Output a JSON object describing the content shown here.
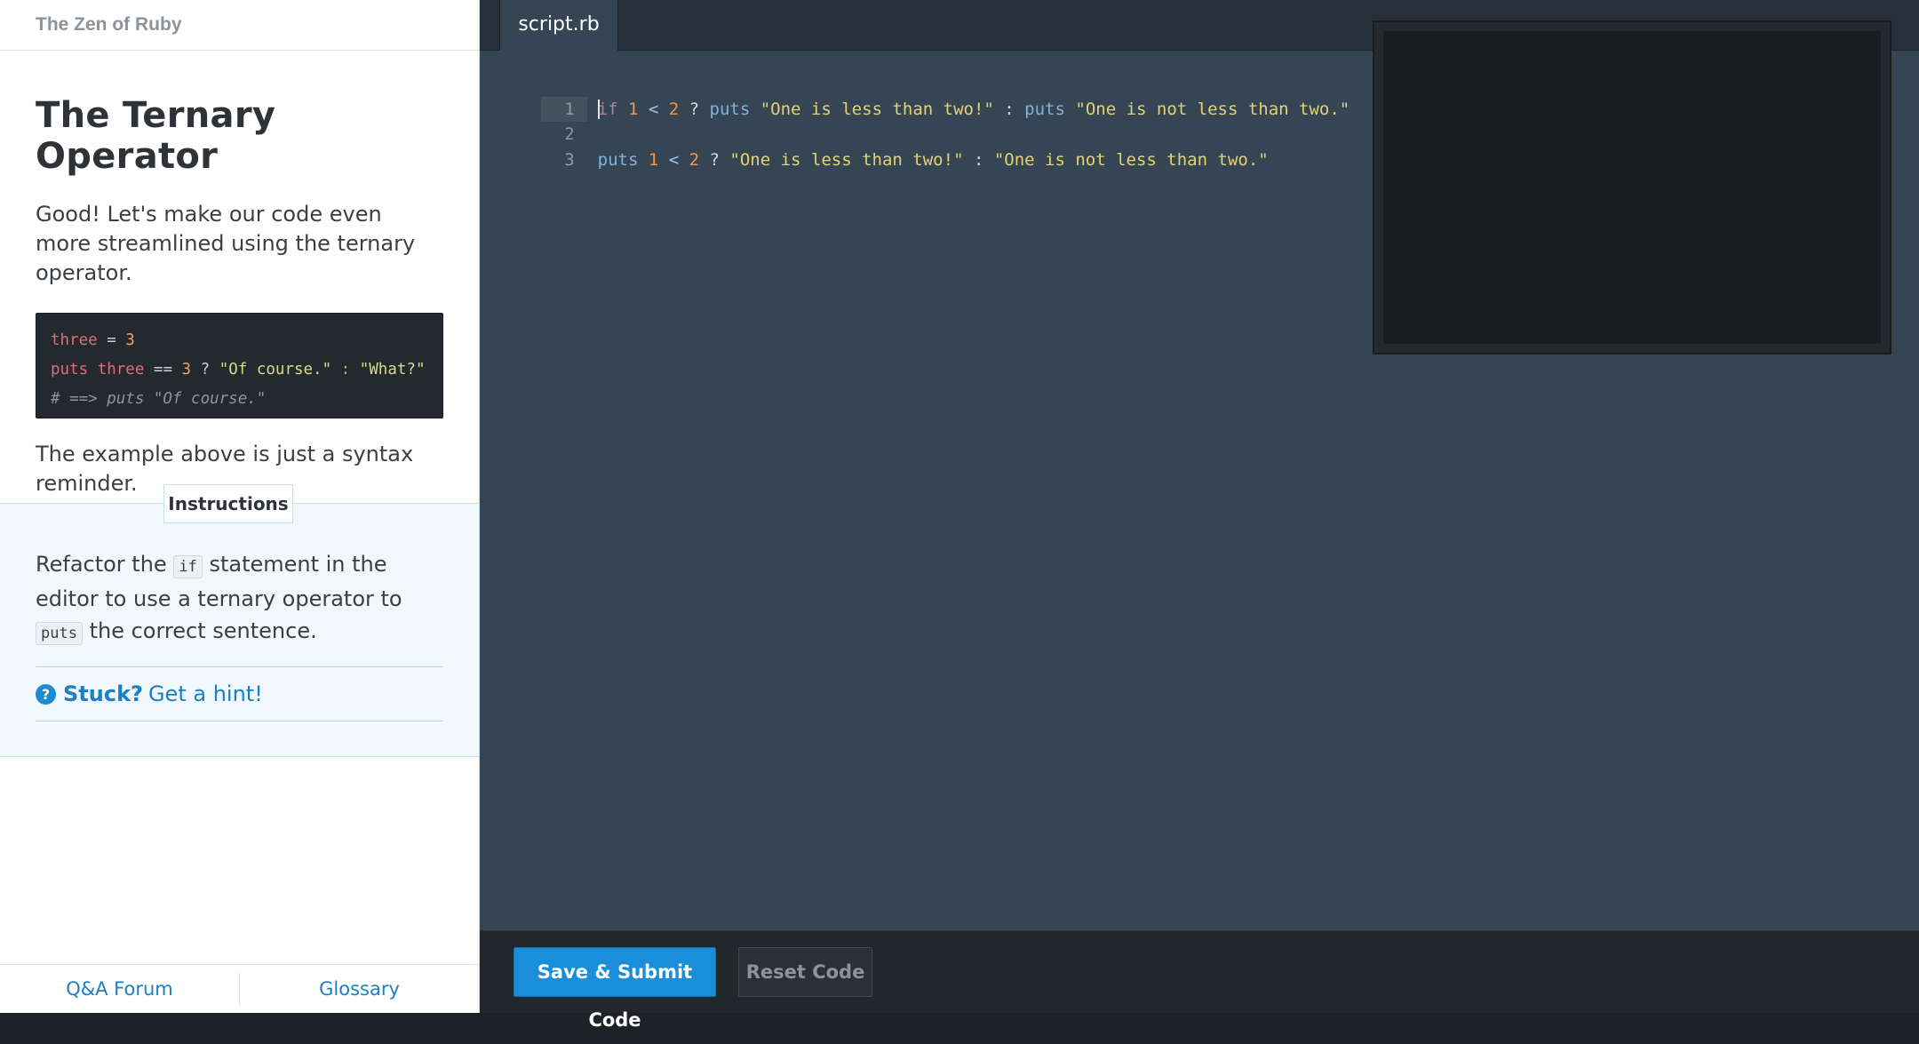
{
  "sidebar": {
    "course_title": "The Zen of Ruby",
    "lesson_title": "The Ternary Operator",
    "intro": "Good! Let's make our code even more streamlined using the ternary operator.",
    "example_code": {
      "line1": {
        "var": "three",
        "op": " = ",
        "num": "3"
      },
      "line2": {
        "kw": "puts",
        "var": " three",
        "op1": " == ",
        "num": "3",
        "op2": " ? ",
        "str1": "\"Of course.\"",
        "colon": " : ",
        "str2": "\"What?\""
      },
      "line3": "# ==> puts \"Of course.\""
    },
    "reminder": "The example above is just a syntax reminder.",
    "instructions_label": "Instructions",
    "instructions": {
      "part1": "Refactor the ",
      "code1": "if",
      "part2": " statement in the editor to use a ternary operator to ",
      "code2": "puts",
      "part3": " the correct sentence."
    },
    "hint": {
      "icon_glyph": "?",
      "strong": "Stuck?",
      "link": "Get a hint!"
    },
    "footer": {
      "forum": "Q&A Forum",
      "glossary": "Glossary"
    }
  },
  "editor": {
    "tab_label": "script.rb",
    "lines": [
      {
        "number": "1",
        "kw": "if",
        "n1": " 1",
        "lt": " <",
        "n2": " 2",
        "q": " ?",
        "fn1": " puts",
        "s1": " \"One is less than two!\"",
        "colon": " :",
        "fn2": " puts",
        "s2": " \"One is not less than two.\""
      },
      {
        "number": "2"
      },
      {
        "number": "3",
        "fn1": "puts",
        "n1": " 1",
        "lt": " <",
        "n2": " 2",
        "q": " ?",
        "s1": " \"One is less than two!\"",
        "colon": " :",
        "s2": " \"One is not less than two.\""
      }
    ],
    "submit_label": "Save & Submit Code",
    "reset_label": "Reset Code"
  }
}
